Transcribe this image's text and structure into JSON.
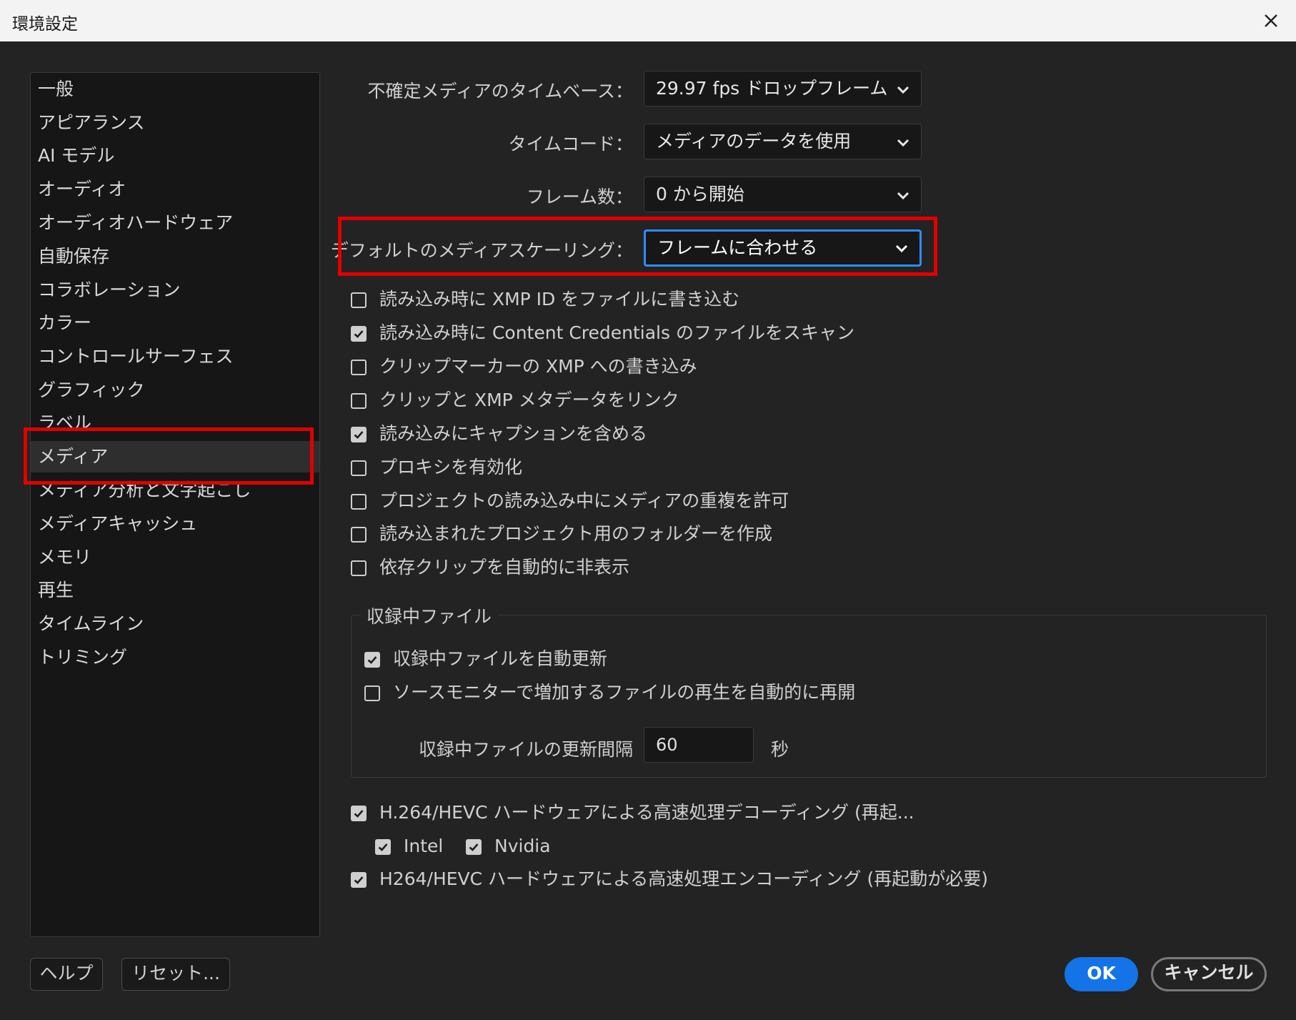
{
  "window": {
    "title": "環境設定"
  },
  "sidebar": {
    "items": [
      {
        "label": "一般"
      },
      {
        "label": "アピアランス"
      },
      {
        "label": "AI モデル"
      },
      {
        "label": "オーディオ"
      },
      {
        "label": "オーディオハードウェア"
      },
      {
        "label": "自動保存"
      },
      {
        "label": "コラボレーション"
      },
      {
        "label": "カラー"
      },
      {
        "label": "コントロールサーフェス"
      },
      {
        "label": "グラフィック"
      },
      {
        "label": "ラベル"
      },
      {
        "label": "メディア"
      },
      {
        "label": "メディア分析と文字起こし"
      },
      {
        "label": "メディアキャッシュ"
      },
      {
        "label": "メモリ"
      },
      {
        "label": "再生"
      },
      {
        "label": "タイムライン"
      },
      {
        "label": "トリミング"
      }
    ],
    "selected": "メディア"
  },
  "settings": {
    "timebase": {
      "label": "不確定メディアのタイムベース：",
      "value": "29.97 fps ドロップフレーム"
    },
    "timecode": {
      "label": "タイムコード：",
      "value": "メディアのデータを使用"
    },
    "frame_count": {
      "label": "フレーム数：",
      "value": "0 から開始"
    },
    "scaling": {
      "label": "デフォルトのメディアスケーリング：",
      "value": "フレームに合わせる"
    }
  },
  "checkboxes": [
    {
      "label": "読み込み時に XMP ID をファイルに書き込む",
      "checked": false
    },
    {
      "label": "読み込み時に Content Credentials のファイルをスキャン",
      "checked": true
    },
    {
      "label": "クリップマーカーの XMP への書き込み",
      "checked": false
    },
    {
      "label": "クリップと XMP メタデータをリンク",
      "checked": false
    },
    {
      "label": "読み込みにキャプションを含める",
      "checked": true
    },
    {
      "label": "プロキシを有効化",
      "checked": false
    },
    {
      "label": "プロジェクトの読み込み中にメディアの重複を許可",
      "checked": false
    },
    {
      "label": "読み込まれたプロジェクト用のフォルダーを作成",
      "checked": false
    },
    {
      "label": "依存クリップを自動的に非表示",
      "checked": false
    }
  ],
  "growing_files": {
    "legend": "収録中ファイル",
    "auto_refresh": {
      "label": "収録中ファイルを自動更新",
      "checked": true
    },
    "auto_resume": {
      "label": "ソースモニターで増加するファイルの再生を自動的に再開",
      "checked": false
    },
    "interval_label": "収録中ファイルの更新間隔",
    "interval_value": "60",
    "interval_unit": "秒"
  },
  "hardware": {
    "decoding": {
      "label": "H.264/HEVC ハードウェアによる高速処理デコーディング (再起...",
      "checked": true
    },
    "intel": {
      "label": "Intel",
      "checked": true
    },
    "nvidia": {
      "label": "Nvidia",
      "checked": true
    },
    "encoding": {
      "label": "H264/HEVC ハードウェアによる高速処理エンコーディング (再起動が必要)",
      "checked": true
    }
  },
  "buttons": {
    "help": "ヘルプ",
    "reset": "リセット...",
    "ok": "OK",
    "cancel": "キャンセル"
  },
  "colors": {
    "highlight": "#e00000",
    "accent": "#1473e6",
    "focus": "#2f8cff"
  },
  "icons": {
    "close": "close-icon",
    "dropdown": "chevron-down-icon",
    "check": "checkmark-icon"
  }
}
